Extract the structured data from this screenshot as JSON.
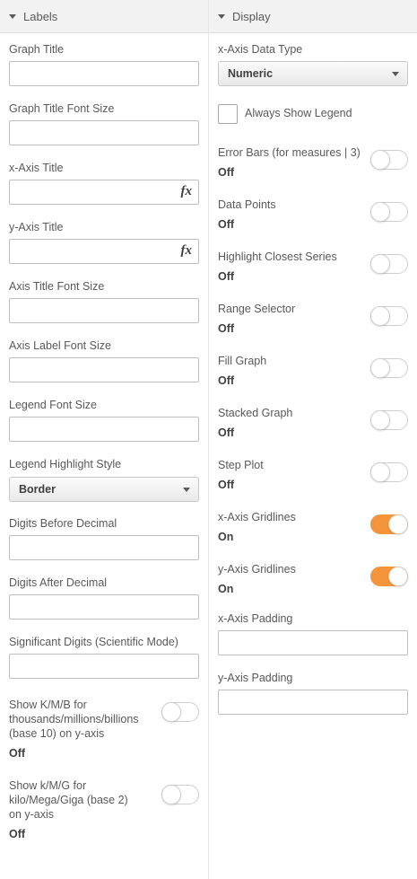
{
  "labels_panel": {
    "header": "Labels",
    "graph_title": {
      "label": "Graph Title",
      "value": ""
    },
    "graph_title_font_size": {
      "label": "Graph Title Font Size",
      "value": ""
    },
    "x_axis_title": {
      "label": "x-Axis Title",
      "value": "",
      "fx": "fx"
    },
    "y_axis_title": {
      "label": "y-Axis Title",
      "value": "",
      "fx": "fx"
    },
    "axis_title_font_size": {
      "label": "Axis Title Font Size",
      "value": ""
    },
    "axis_label_font_size": {
      "label": "Axis Label Font Size",
      "value": ""
    },
    "legend_font_size": {
      "label": "Legend Font Size",
      "value": ""
    },
    "legend_highlight_style": {
      "label": "Legend Highlight Style",
      "selected": "Border"
    },
    "digits_before_decimal": {
      "label": "Digits Before Decimal",
      "value": ""
    },
    "digits_after_decimal": {
      "label": "Digits After Decimal",
      "value": ""
    },
    "significant_digits": {
      "label": "Significant Digits (Scientific Mode)",
      "value": ""
    },
    "kmb_toggle": {
      "label": "Show K/M/B for thousands/millions/billions (base 10) on y-axis",
      "state": "Off"
    },
    "kmg_toggle": {
      "label": "Show k/M/G for kilo/Mega/Giga (base 2) on y-axis",
      "state": "Off"
    }
  },
  "display_panel": {
    "header": "Display",
    "x_axis_data_type": {
      "label": "x-Axis Data Type",
      "selected": "Numeric"
    },
    "always_show_legend": {
      "label": "Always Show Legend",
      "checked": false
    },
    "toggles": [
      {
        "label": "Error Bars (for measures | 3)",
        "state": "Off",
        "on": false
      },
      {
        "label": "Data Points",
        "state": "Off",
        "on": false
      },
      {
        "label": "Highlight Closest Series",
        "state": "Off",
        "on": false
      },
      {
        "label": "Range Selector",
        "state": "Off",
        "on": false
      },
      {
        "label": "Fill Graph",
        "state": "Off",
        "on": false
      },
      {
        "label": "Stacked Graph",
        "state": "Off",
        "on": false
      },
      {
        "label": "Step Plot",
        "state": "Off",
        "on": false
      },
      {
        "label": "x-Axis Gridlines",
        "state": "On",
        "on": true
      },
      {
        "label": "y-Axis Gridlines",
        "state": "On",
        "on": true
      }
    ],
    "x_axis_padding": {
      "label": "x-Axis Padding",
      "value": ""
    },
    "y_axis_padding": {
      "label": "y-Axis Padding",
      "value": ""
    }
  },
  "colors": {
    "toggle_on": "#f5953b",
    "header_bg": "#f2f2f2"
  }
}
